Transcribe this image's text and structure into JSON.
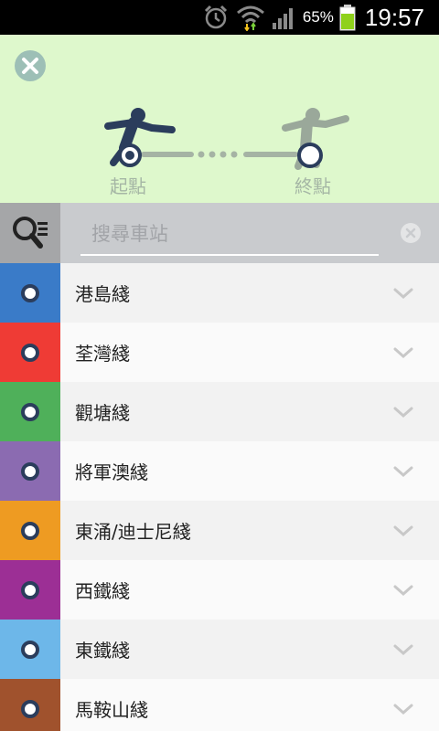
{
  "status_bar": {
    "battery_percent": "65%",
    "time": "19:57",
    "icons": [
      "alarm-icon",
      "wifi-icon",
      "signal-icon",
      "battery-icon"
    ]
  },
  "route": {
    "start_label": "起點",
    "end_label": "終點"
  },
  "search": {
    "placeholder": "搜尋車站"
  },
  "lines": [
    {
      "name": "港島綫",
      "color": "#3a7bc8"
    },
    {
      "name": "荃灣綫",
      "color": "#ef3b35"
    },
    {
      "name": "觀塘綫",
      "color": "#4fb05a"
    },
    {
      "name": "將軍澳綫",
      "color": "#8b6bb1"
    },
    {
      "name": "東涌/迪士尼綫",
      "color": "#ee9b22"
    },
    {
      "name": "西鐵綫",
      "color": "#9c2f95"
    },
    {
      "name": "東鐵綫",
      "color": "#6db7e9"
    },
    {
      "name": "馬鞍山綫",
      "color": "#a0522d"
    }
  ],
  "colors": {
    "route_panel_bg": "#def8cc",
    "accent_dark": "#2b3d5c",
    "inactive_gray": "#9aa89a"
  }
}
